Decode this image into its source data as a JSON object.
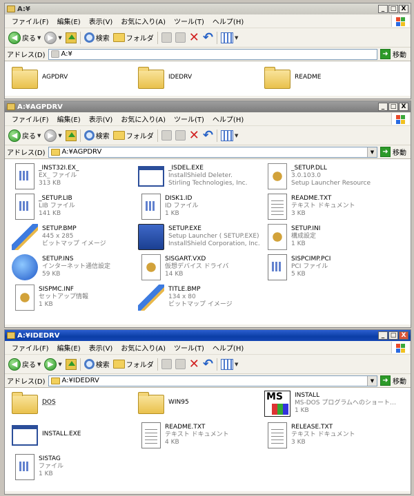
{
  "menus": [
    "ファイル(F)",
    "編集(E)",
    "表示(V)",
    "お気に入り(A)",
    "ツール(T)",
    "ヘルプ(H)"
  ],
  "toolbar": {
    "back": "戻る",
    "search": "検索",
    "folders": "フォルダ"
  },
  "address_label": "アドレス(D)",
  "go_label": "移動",
  "caption_buttons": {
    "minimize": "_",
    "maximize": "□",
    "close": "X"
  },
  "windows": [
    {
      "title": "A:¥",
      "address": "A:¥",
      "items": [
        {
          "name": "AGPDRV",
          "type": "folder"
        },
        {
          "name": "IDEDRV",
          "type": "folder"
        },
        {
          "name": "README",
          "type": "folder"
        }
      ]
    },
    {
      "title": "A:¥AGPDRV",
      "address": "A:¥AGPDRV",
      "items": [
        {
          "name": "_INST32I.EX_",
          "line2": "EX_ ファイル",
          "line3": "313 KB",
          "type": "doc"
        },
        {
          "name": "_ISDEL.EXE",
          "line2": "InstallShield Deleter.",
          "line3": "Stirling Technologies, Inc.",
          "type": "winapp"
        },
        {
          "name": "_SETUP.DLL",
          "line2": "3.0.103.0",
          "line3": "Setup Launcher Resource",
          "type": "gear"
        },
        {
          "name": "_SETUP.LIB",
          "line2": "LIB ファイル",
          "line3": "141 KB",
          "type": "doc"
        },
        {
          "name": "DISK1.ID",
          "line2": "ID ファイル",
          "line3": "1 KB",
          "type": "doc"
        },
        {
          "name": "README.TXT",
          "line2": "テキスト ドキュメント",
          "line3": "3 KB",
          "type": "txt"
        },
        {
          "name": "SETUP.BMP",
          "line2": "445 x 285",
          "line3": "ビットマップ イメージ",
          "type": "paint"
        },
        {
          "name": "SETUP.EXE",
          "line2": "Setup Launcher ( SETUP.EXE)",
          "line3": "InstallShield Corporation, Inc.",
          "type": "setupexe"
        },
        {
          "name": "SETUP.INI",
          "line2": "構成設定",
          "line3": "1 KB",
          "type": "gear"
        },
        {
          "name": "SETUP.INS",
          "line2": "インターネット通信設定",
          "line3": "59 KB",
          "type": "globe"
        },
        {
          "name": "SISGART.VXD",
          "line2": "仮想デバイス ドライバ",
          "line3": "14 KB",
          "type": "gear"
        },
        {
          "name": "SISPCIMP.PCI",
          "line2": "PCI ファイル",
          "line3": "5 KB",
          "type": "doc"
        },
        {
          "name": "SISPMC.INF",
          "line2": "セットアップ情報",
          "line3": "1 KB",
          "type": "gear"
        },
        {
          "name": "TITLE.BMP",
          "line2": "134 x 80",
          "line3": "ビットマップ イメージ",
          "type": "paint"
        }
      ]
    },
    {
      "title": "A:¥IDEDRV",
      "address": "A:¥IDEDRV",
      "items": [
        {
          "name": "DOS",
          "type": "folder"
        },
        {
          "name": "WIN95",
          "type": "folder"
        },
        {
          "name": "INSTALL",
          "line2": "MS-DOS プログラムへのショート…",
          "line3": "1 KB",
          "type": "msdos"
        },
        {
          "name": "INSTALL.EXE",
          "type": "winapp"
        },
        {
          "name": "README.TXT",
          "line2": "テキスト ドキュメント",
          "line3": "4 KB",
          "type": "txt"
        },
        {
          "name": "RELEASE.TXT",
          "line2": "テキスト ドキュメント",
          "line3": "3 KB",
          "type": "txt"
        },
        {
          "name": "SISTAG",
          "line2": "ファイル",
          "line3": "1 KB",
          "type": "doc"
        }
      ]
    }
  ],
  "colors": {
    "active_title": "#0b3ea6",
    "inactive_title": "#d6d4cc",
    "content_bg": "#ffffff",
    "chrome_bg": "#f3f1ea"
  }
}
